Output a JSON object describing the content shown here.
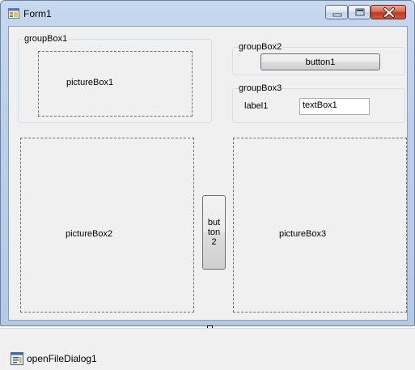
{
  "window": {
    "title": "Form1",
    "controls": {
      "minimize_icon": "minimize-icon",
      "maximize_icon": "maximize-icon",
      "close_icon": "close-icon"
    }
  },
  "colors": {
    "frame": "#b9cfea",
    "client_bg": "#f0f0f0",
    "close_red": "#c0371e"
  },
  "form": {
    "groupBox1": {
      "caption": "groupBox1",
      "pictureBox1": "pictureBox1"
    },
    "groupBox2": {
      "caption": "groupBox2",
      "button1": "button1"
    },
    "groupBox3": {
      "caption": "groupBox3",
      "label1": "label1",
      "textBox1": "textBox1"
    },
    "pictureBox2": "pictureBox2",
    "button2": "but\nton\n2",
    "pictureBox3": "pictureBox3"
  },
  "tray": {
    "component_label": "openFileDialog1",
    "component_icon": "open-file-dialog-icon"
  }
}
